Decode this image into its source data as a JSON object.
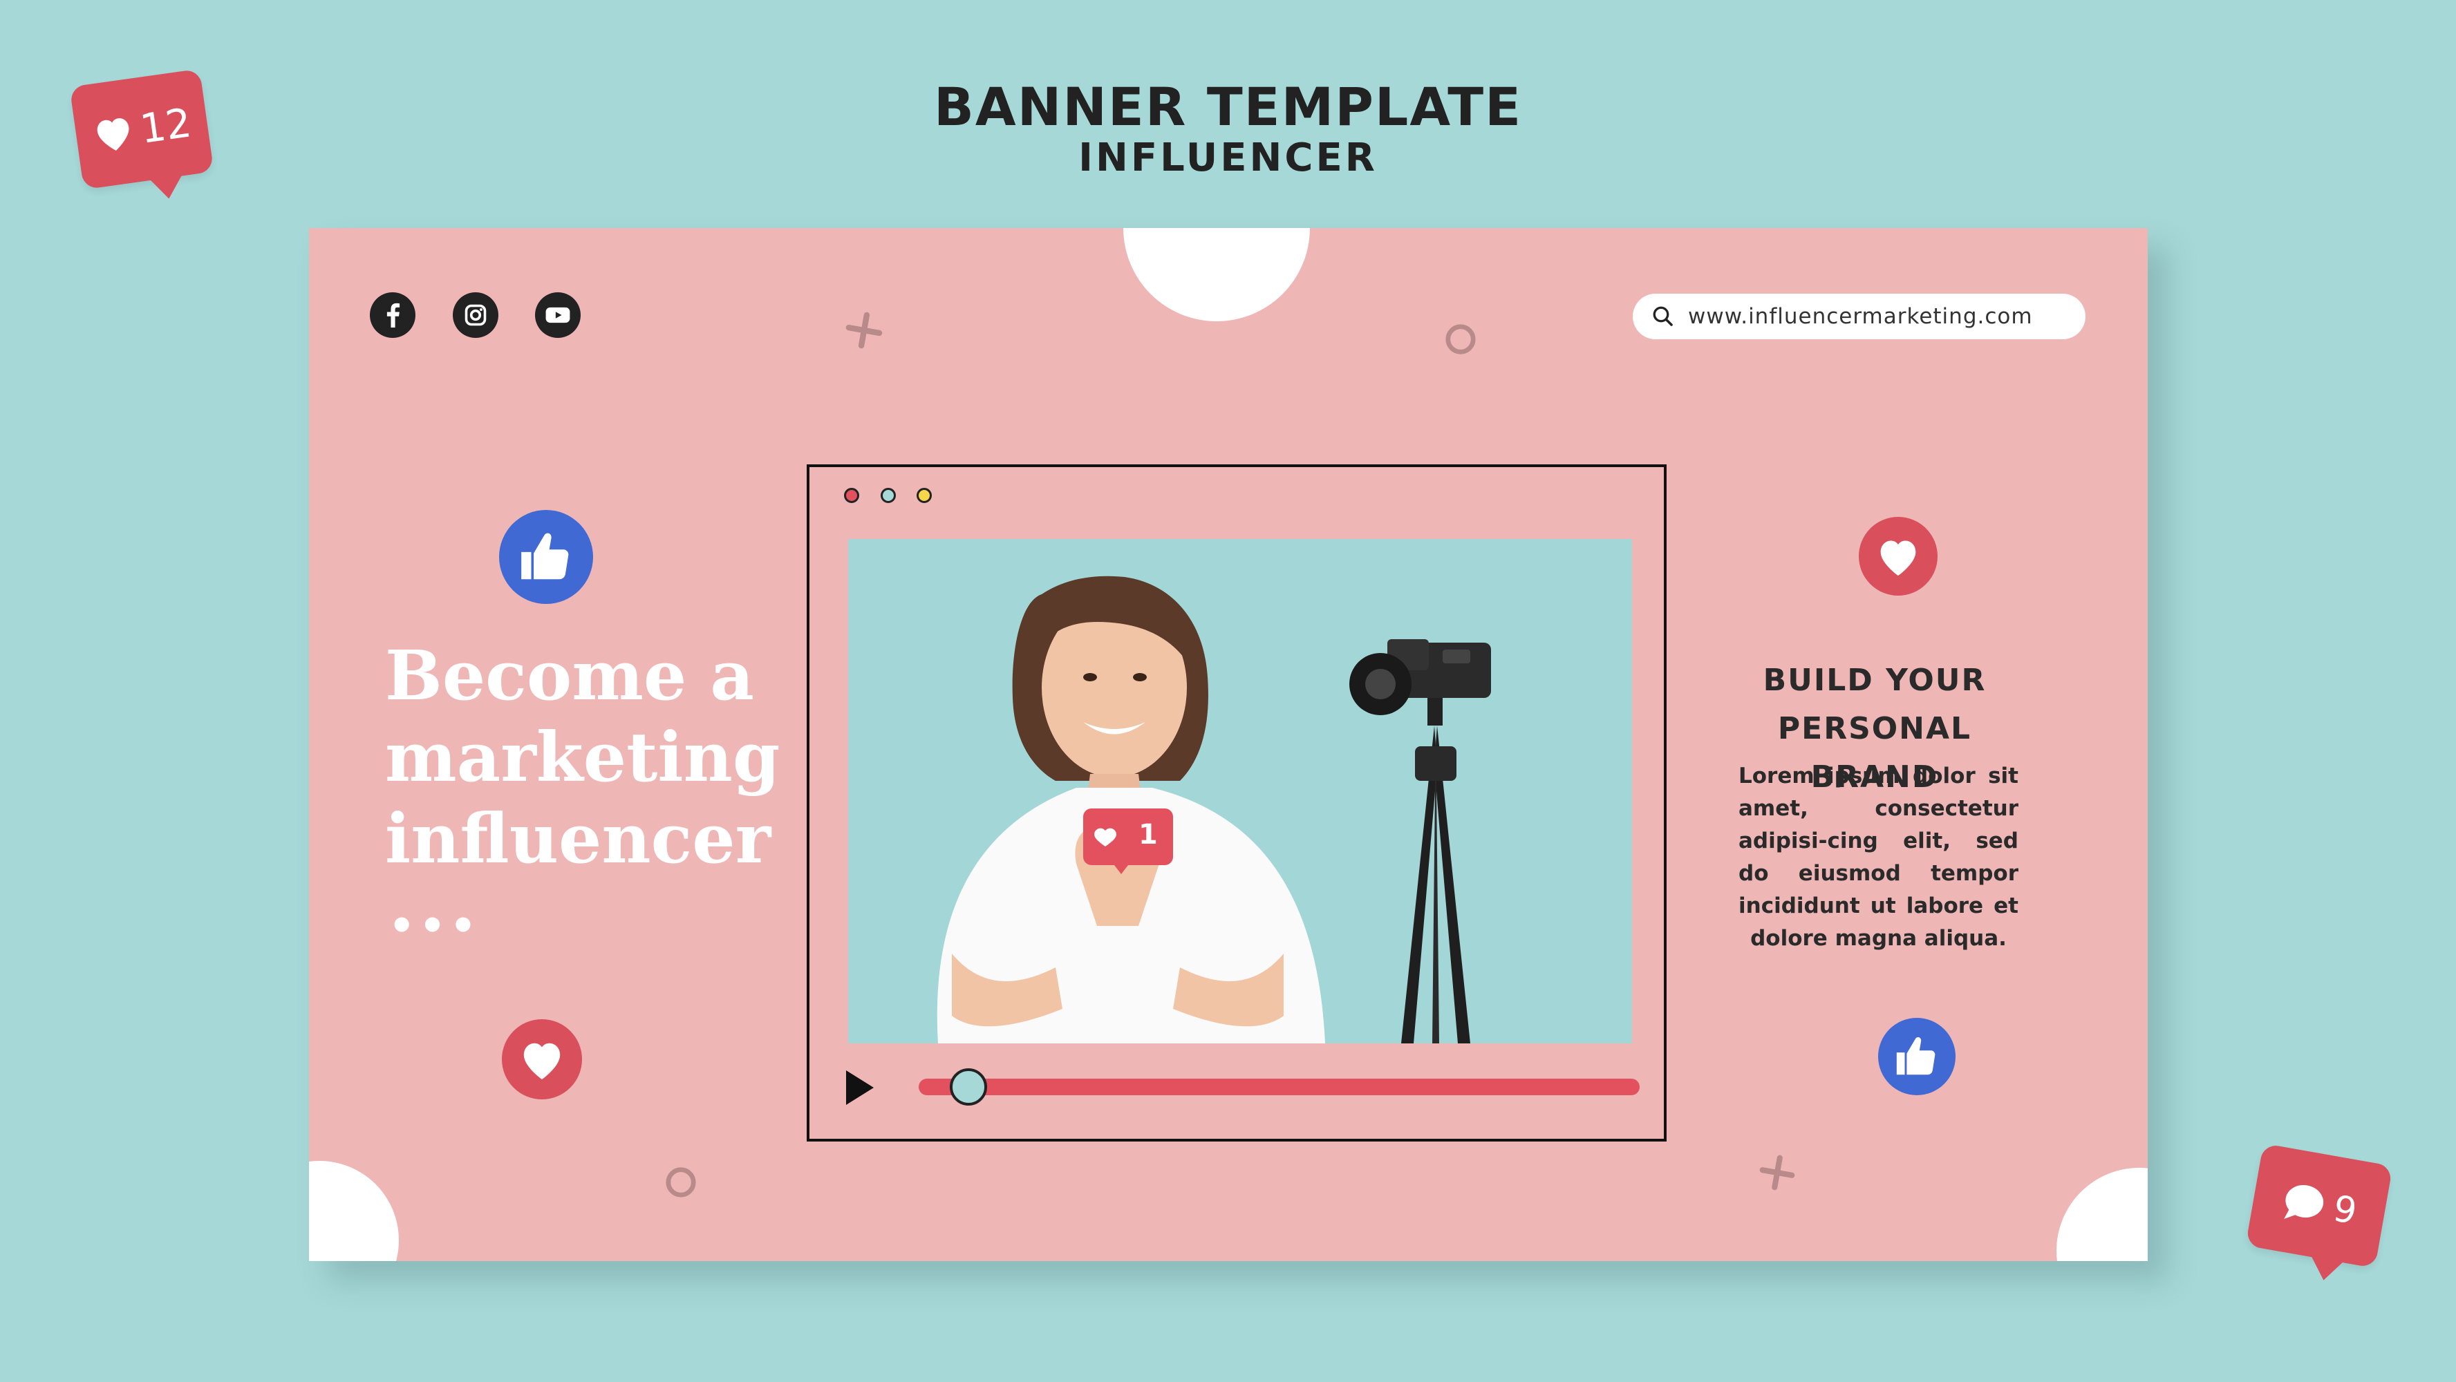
{
  "header": {
    "title": "BANNER TEMPLATE",
    "subtitle": "INFLUENCER"
  },
  "notifications": {
    "likes": "12",
    "comments": "9"
  },
  "social_icons": [
    "facebook-icon",
    "instagram-icon",
    "youtube-icon"
  ],
  "search": {
    "url": "www.influencermarketing.com"
  },
  "headline": {
    "line1": "Become a",
    "line2": "marketing",
    "line3": "influencer",
    "ellipsis": "•••"
  },
  "brand": {
    "title_line1": "BUILD YOUR",
    "title_line2": "PERSONAL BRAND",
    "body": "Lorem ipsum dolor sit amet, consectetur adipisi-cing elit, sed do eiusmod tempor incididunt ut labore et dolore magna aliqua."
  },
  "photo_badge": {
    "likes": "1"
  },
  "video": {
    "progress": 0.05
  },
  "colors": {
    "background": "#a6d8d8",
    "banner": "#efb6b6",
    "accent_red": "#d94f5c",
    "accent_blue": "#4169d4",
    "dark": "#222222"
  }
}
